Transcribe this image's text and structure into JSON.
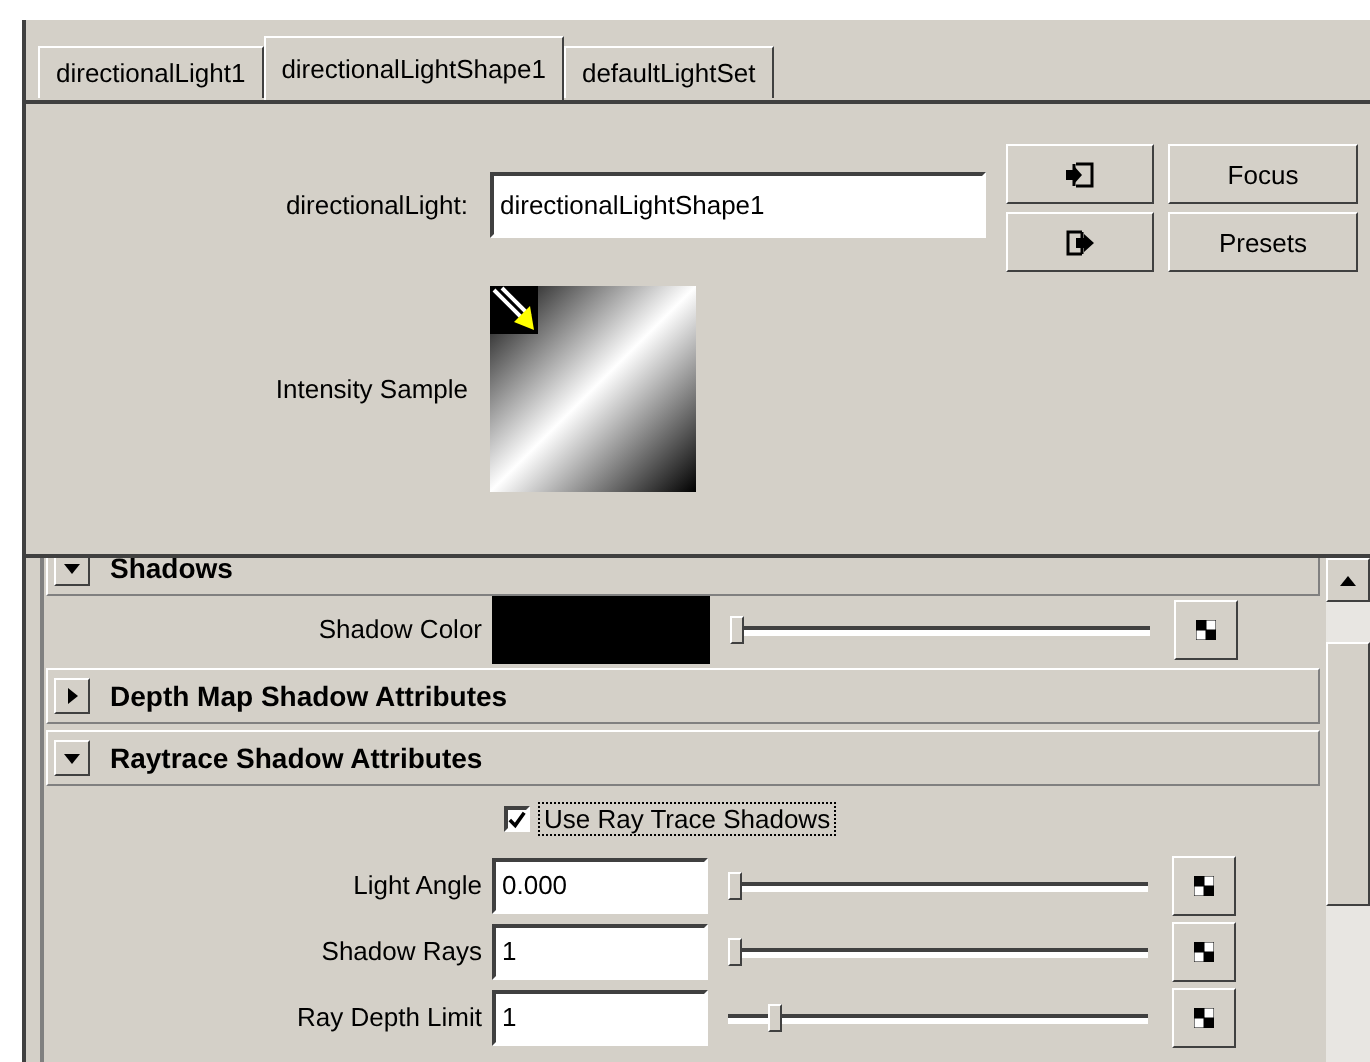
{
  "tabs": [
    {
      "label": "directionalLight1",
      "selected": false
    },
    {
      "label": "directionalLightShape1",
      "selected": true
    },
    {
      "label": "defaultLightSet",
      "selected": false
    }
  ],
  "node": {
    "label": "directionalLight:",
    "value": "directionalLightShape1"
  },
  "buttons": [
    "Focus",
    "Presets"
  ],
  "sample": {
    "label": "Intensity Sample"
  },
  "sections": [
    {
      "title": "Shadows",
      "expanded": true,
      "rows": [
        {
          "kind": "color",
          "label": "Shadow Color",
          "level": 0.0
        }
      ]
    },
    {
      "title": "Depth Map Shadow Attributes",
      "expanded": false
    },
    {
      "title": "Raytrace Shadow Attributes",
      "expanded": true,
      "rows": [
        {
          "kind": "checkbox",
          "label": "Use Ray Trace Shadows",
          "checked": true
        },
        {
          "kind": "slider",
          "label": "Light Angle",
          "value": "0.000",
          "level": 0.0
        },
        {
          "kind": "slider",
          "label": "Shadow Rays",
          "value": "1",
          "level": 0.0
        },
        {
          "kind": "slider",
          "label": "Ray Depth Limit",
          "value": "1",
          "level": 0.1
        }
      ]
    }
  ]
}
